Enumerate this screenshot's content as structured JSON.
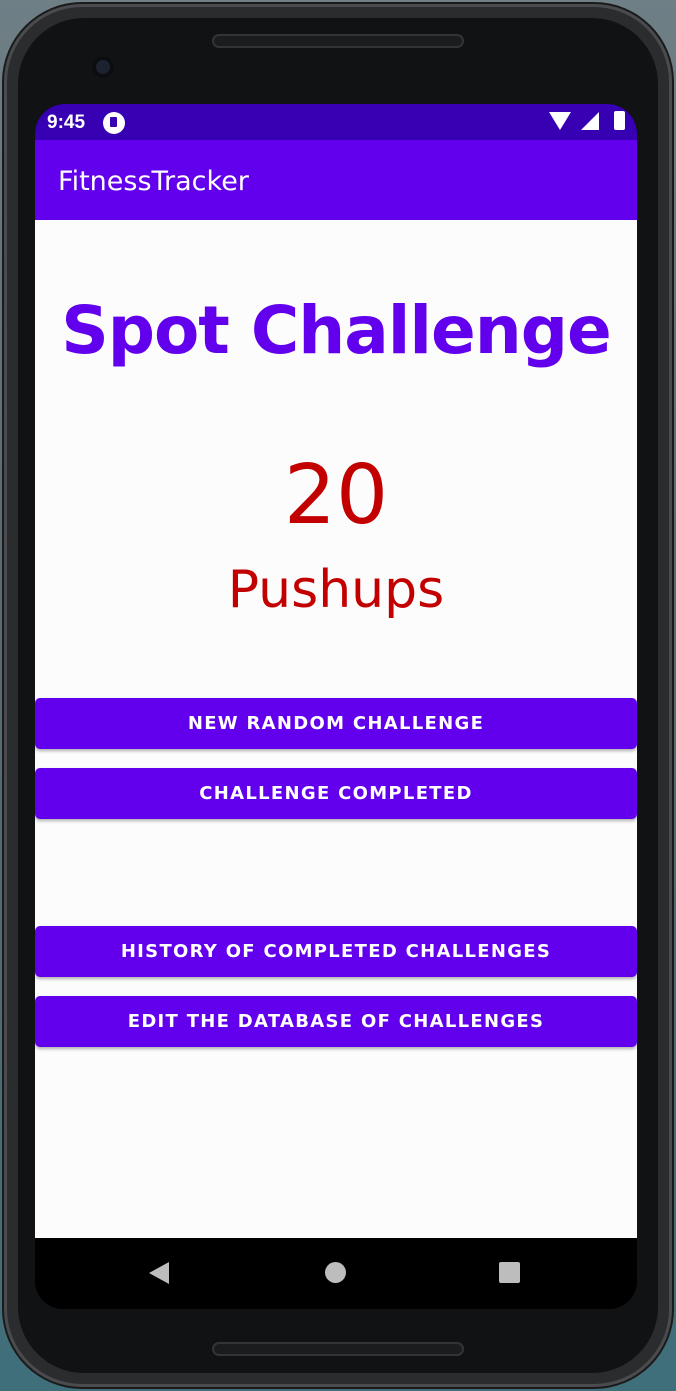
{
  "status_bar": {
    "time": "9:45"
  },
  "app_bar": {
    "title": "FitnessTracker"
  },
  "challenge": {
    "heading": "Spot Challenge",
    "count": "20",
    "unit": "Pushups"
  },
  "buttons": {
    "new_random": "NEW RANDOM CHALLENGE",
    "completed": "CHALLENGE COMPLETED",
    "history": "HISTORY OF COMPLETED CHALLENGES",
    "edit_database": "EDIT THE DATABASE OF CHALLENGES"
  },
  "icons": {
    "status": [
      "notification-icon",
      "wifi-icon",
      "signal-icon",
      "battery-icon"
    ],
    "navigation": [
      "back-icon",
      "home-icon",
      "recents-icon"
    ]
  },
  "colors": {
    "primary": "#6200ee",
    "primary_dark": "#3700b3",
    "challenge_text": "#c30000"
  }
}
